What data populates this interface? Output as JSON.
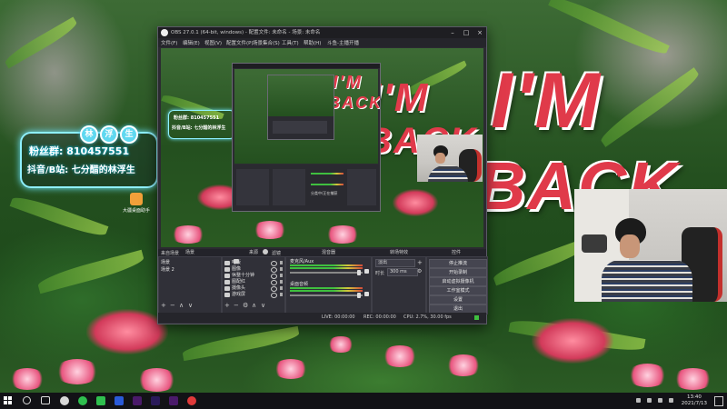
{
  "overlay": {
    "big_text_1": "I'M",
    "big_text_2": "BACK",
    "fan_name_chars": [
      "林",
      "浮",
      "生"
    ],
    "fan_line1": "粉丝群: 810457551",
    "fan_line2": "抖音/B站: 七分醋的林浮生"
  },
  "desktop": {
    "icon_label": "大疆桌面助手"
  },
  "obs": {
    "title": "OBS 27.0.1 (64-bit, windows) - 配置文件: 未命名 - 场景: 未命名",
    "menu": [
      "文件(F)",
      "编辑(E)",
      "视图(V)",
      "配置文件(P)",
      "场景集合(S)",
      "工具(T)",
      "帮助(H)",
      "斗鱼-主播开播"
    ],
    "dock": {
      "scene_tab": "来自场景",
      "filter_tab": "滤镜",
      "panels": {
        "scenes": "场景",
        "sources": "来源",
        "mixer": "混音器",
        "transitions": "转场特效",
        "controls": "控件"
      }
    },
    "scenes": [
      "场景",
      "场景 2"
    ],
    "sources": [
      "吃饭",
      "图像",
      "休整十分钟",
      "图配红",
      "摄像头",
      "游戏屏"
    ],
    "mixer": [
      {
        "label": "麦克风/Aux"
      },
      {
        "label": "桌面音频"
      }
    ],
    "transitions": {
      "type": "淡出",
      "duration_label": "时长",
      "duration_value": "300 ms"
    },
    "controls": [
      "停止推流",
      "开始录制",
      "启动虚拟摄像机",
      "工作室模式",
      "设置",
      "退出"
    ],
    "status": {
      "live": "LIVE: 00:00:00",
      "rec": "REC: 00:00:00",
      "cpu": "CPU: 2.7%, 30.00 fps"
    },
    "nested_label": "分类中/正在捕获"
  },
  "taskbar": {
    "time": "13:40",
    "date": "2021/7/13"
  },
  "colors": {
    "accent_red": "#e03a4a",
    "cyan_glow": "#8ef0ff",
    "obs_bg": "#2b2b31"
  }
}
